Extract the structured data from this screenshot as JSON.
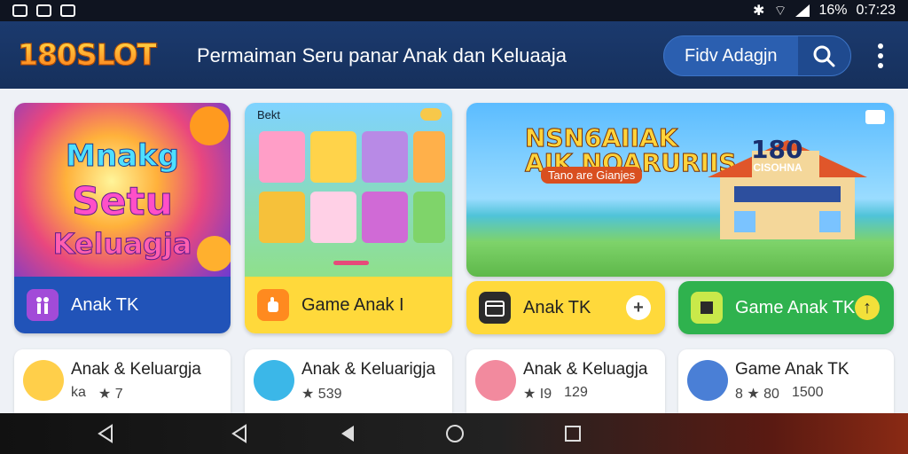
{
  "status_bar": {
    "battery": "16%",
    "time": "0:7:23",
    "icons": [
      "twitch-icon",
      "n-app-icon",
      "mail-icon",
      "bluetooth-icon",
      "wifi-icon",
      "signal-icon"
    ]
  },
  "header": {
    "logo": "180SLOT",
    "tagline": "Permaiman Seru panar Anak dan Keluaaja",
    "action_button": "Fidv Adagjn",
    "search_icon": "search-icon",
    "menu_icon": "more-vertical-icon"
  },
  "cards": [
    {
      "art_lines": [
        "Mnakg",
        "Setu",
        "Keluagja"
      ],
      "label": "Anak TK",
      "icon": "people-icon",
      "color": "#2153b8"
    },
    {
      "art_badge": "Bekt",
      "label": "Game Anak I",
      "icon": "hand-icon",
      "color": "#ffd93b"
    },
    {
      "art_title": "NSN6AIIAK\nAIK NOARURIIS",
      "art_subtitle": "Tano are Gianjes",
      "art_sign": "CISOHNA",
      "art_number": "180"
    }
  ],
  "pills": [
    {
      "label": "Anak TK",
      "icon": "calendar-icon",
      "action_icon": "plus-icon",
      "color": "#ffd93b"
    },
    {
      "label": "Game Anak TK",
      "icon": "flag-icon",
      "action_icon": "arrow-icon",
      "color": "#2fb24e"
    }
  ],
  "list_items": [
    {
      "title": "Anak & Keluargja",
      "meta": [
        "ka",
        "★ 7"
      ]
    },
    {
      "title": "Anak & Keluarigja",
      "meta": [
        "★ 539"
      ]
    },
    {
      "title": "Anak & Keluagja",
      "meta": [
        "★ I9",
        "129"
      ]
    },
    {
      "title": "Game Anak TK",
      "meta": [
        "8 ★ 80",
        "1500"
      ]
    }
  ],
  "nav_bar": [
    "back-icon",
    "back-icon",
    "home-icon",
    "recents-icon"
  ]
}
